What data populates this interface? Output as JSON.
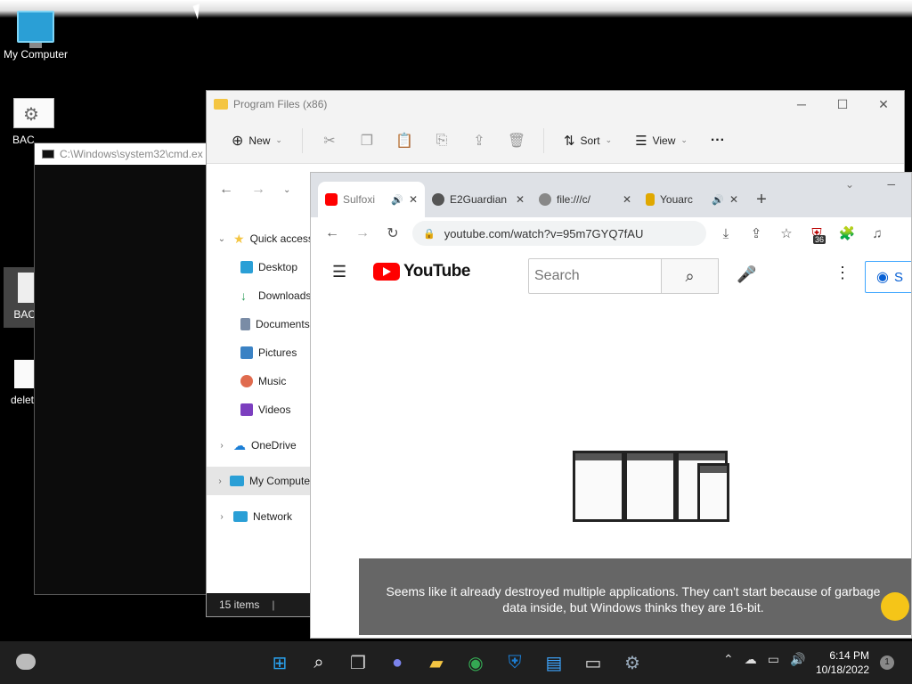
{
  "desktop": {
    "icons": [
      {
        "label": "My Computer"
      },
      {
        "label": "BAC"
      },
      {
        "label": "BAC"
      },
      {
        "label": "delet"
      }
    ]
  },
  "cmd": {
    "title": "C:\\Windows\\system32\\cmd.ex"
  },
  "explorer": {
    "title": "Program Files (x86)",
    "toolbar": {
      "new_label": "New",
      "sort_label": "Sort",
      "view_label": "View"
    },
    "tree": [
      {
        "label": "Quick access",
        "icon_color": "#f4c542",
        "level": 1,
        "chevron": "⌄"
      },
      {
        "label": "Desktop",
        "icon_color": "#2a9fd6",
        "level": 2
      },
      {
        "label": "Downloads",
        "icon_color": "#2e9e5b",
        "level": 2
      },
      {
        "label": "Documents",
        "icon_color": "#7a8ca6",
        "level": 2
      },
      {
        "label": "Pictures",
        "icon_color": "#3b82c4",
        "level": 2
      },
      {
        "label": "Music",
        "icon_color": "#e06b4e",
        "level": 2
      },
      {
        "label": "Videos",
        "icon_color": "#7c3fbf",
        "level": 2
      },
      {
        "label": "OneDrive",
        "icon_color": "#1c7fd6",
        "level": 1,
        "chevron": "›"
      },
      {
        "label": "My Computer",
        "icon_color": "#2a9fd6",
        "level": 1,
        "chevron": "›",
        "selected": true
      },
      {
        "label": "Network",
        "icon_color": "#2a9fd6",
        "level": 1,
        "chevron": "›"
      }
    ],
    "status": "15 items"
  },
  "chrome": {
    "tabs": [
      {
        "label": "Sulfoxi",
        "favicon_color": "#ff0000",
        "audio": true,
        "active": true
      },
      {
        "label": "E2Guardian",
        "favicon_color": "#555555",
        "audio": false,
        "active": false
      },
      {
        "label": "file:///c/",
        "favicon_color": "#888888",
        "audio": false,
        "active": false
      },
      {
        "label": "Youarc",
        "favicon_color": "#e0a800",
        "audio": true,
        "active": false
      }
    ],
    "url": "youtube.com/watch?v=95m7GYQ7fAU",
    "ext_badge": "36"
  },
  "youtube": {
    "logo_text": "YouTube",
    "search_placeholder": "Search",
    "signin_label": "S"
  },
  "video": {
    "caption": "Seems like it already destroyed multiple applications. They can't start because of garbage data inside, but Windows thinks they are 16-bit."
  },
  "taskbar": {
    "time": "6:14 PM",
    "date": "10/18/2022",
    "notification_count": "1"
  },
  "colors": {
    "youtube_red": "#ff0000",
    "signin_blue": "#065fd4",
    "taskbar_bg": "#1f1f1f"
  }
}
